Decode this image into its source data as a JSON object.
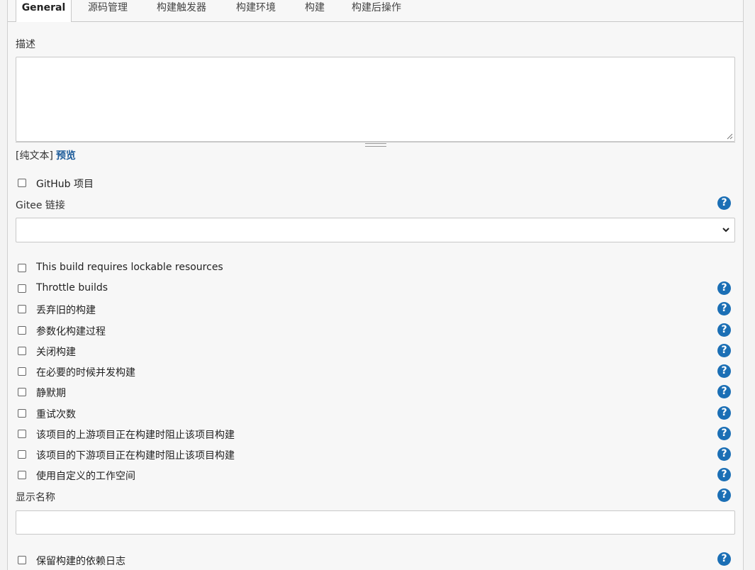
{
  "tabs": [
    {
      "label": "General",
      "active": true
    },
    {
      "label": "源码管理"
    },
    {
      "label": "构建触发器"
    },
    {
      "label": "构建环境"
    },
    {
      "label": "构建"
    },
    {
      "label": "构建后操作"
    }
  ],
  "description": {
    "label": "描述",
    "value": "",
    "markup_plain": "[纯文本]",
    "markup_preview": "预览"
  },
  "github_project": {
    "label": "GitHub 项目",
    "checked": false
  },
  "gitee": {
    "label": "Gitee 链接",
    "selected": ""
  },
  "options": [
    {
      "label": "This build requires lockable resources",
      "checked": false,
      "help": false
    },
    {
      "label": "Throttle builds",
      "checked": false,
      "help": true
    },
    {
      "label": "丢弃旧的构建",
      "checked": false,
      "help": true
    },
    {
      "label": "参数化构建过程",
      "checked": false,
      "help": true
    },
    {
      "label": "关闭构建",
      "checked": false,
      "help": true
    },
    {
      "label": "在必要的时候并发构建",
      "checked": false,
      "help": true
    },
    {
      "label": "静默期",
      "checked": false,
      "help": true
    },
    {
      "label": "重试次数",
      "checked": false,
      "help": true
    },
    {
      "label": "该项目的上游项目正在构建时阻止该项目构建",
      "checked": false,
      "help": true
    },
    {
      "label": "该项目的下游项目正在构建时阻止该项目构建",
      "checked": false,
      "help": true
    },
    {
      "label": "使用自定义的工作空间",
      "checked": false,
      "help": true
    }
  ],
  "display_name": {
    "label": "显示名称",
    "value": ""
  },
  "keep_log": {
    "label": "保留构建的依赖日志",
    "checked": false
  },
  "help_glyph": "?",
  "help_icon_color": "#1b6fb5",
  "link_color": "#1d5c9a"
}
